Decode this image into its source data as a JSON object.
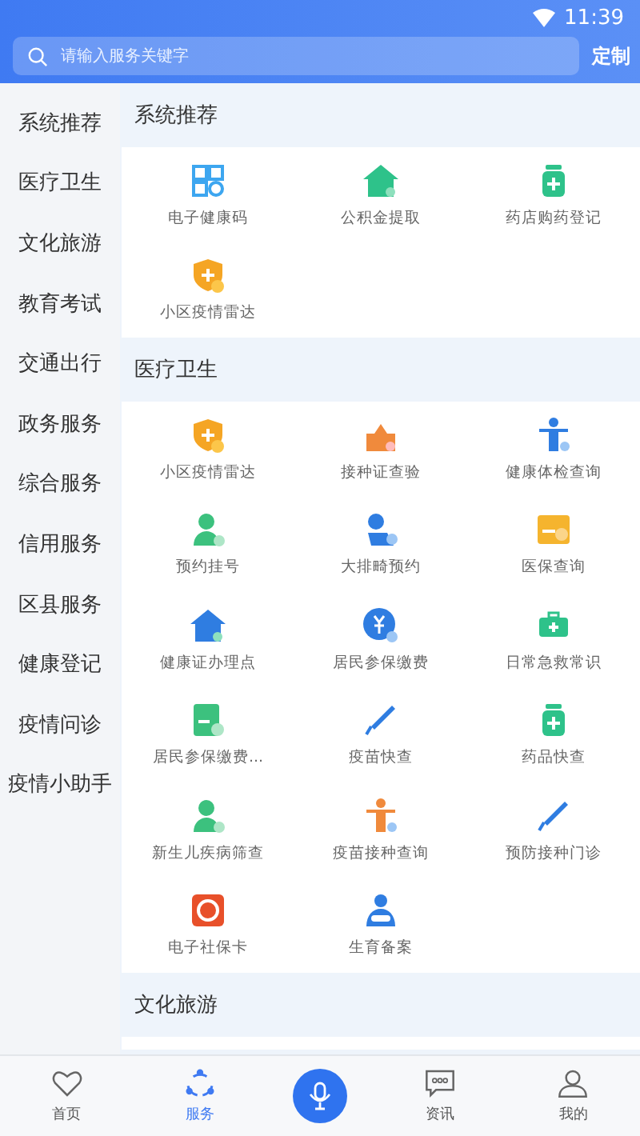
{
  "status_bar": {
    "time": "11:39"
  },
  "search": {
    "placeholder": "请输入服务关键字",
    "action": "定制"
  },
  "sidebar": {
    "items": [
      {
        "label": "系统推荐"
      },
      {
        "label": "医疗卫生"
      },
      {
        "label": "文化旅游"
      },
      {
        "label": "教育考试"
      },
      {
        "label": "交通出行"
      },
      {
        "label": "政务服务"
      },
      {
        "label": "综合服务"
      },
      {
        "label": "信用服务"
      },
      {
        "label": "区县服务"
      },
      {
        "label": "健康登记"
      },
      {
        "label": "疫情问诊"
      },
      {
        "label": "疫情小助手"
      }
    ]
  },
  "sections": [
    {
      "title": "系统推荐",
      "items": [
        "电子健康码",
        "公积金提取",
        "药店购药登记",
        "小区疫情雷达"
      ]
    },
    {
      "title": "医疗卫生",
      "items": [
        "小区疫情雷达",
        "接种证查验",
        "健康体检查询",
        "预约挂号",
        "大排畸预约",
        "医保查询",
        "健康证办理点",
        "居民参保缴费",
        "日常急救常识",
        "居民参保缴费...",
        "疫苗快查",
        "药品快查",
        "新生儿疾病筛查",
        "疫苗接种查询",
        "预防接种门诊",
        "电子社保卡",
        "生育备案"
      ]
    },
    {
      "title": "文化旅游"
    }
  ],
  "bottom_nav": [
    {
      "label": "首页",
      "selected": false
    },
    {
      "label": "服务",
      "selected": true
    },
    {
      "kind": "voice"
    },
    {
      "label": "资讯",
      "selected": false
    },
    {
      "label": "我的",
      "selected": false
    }
  ]
}
